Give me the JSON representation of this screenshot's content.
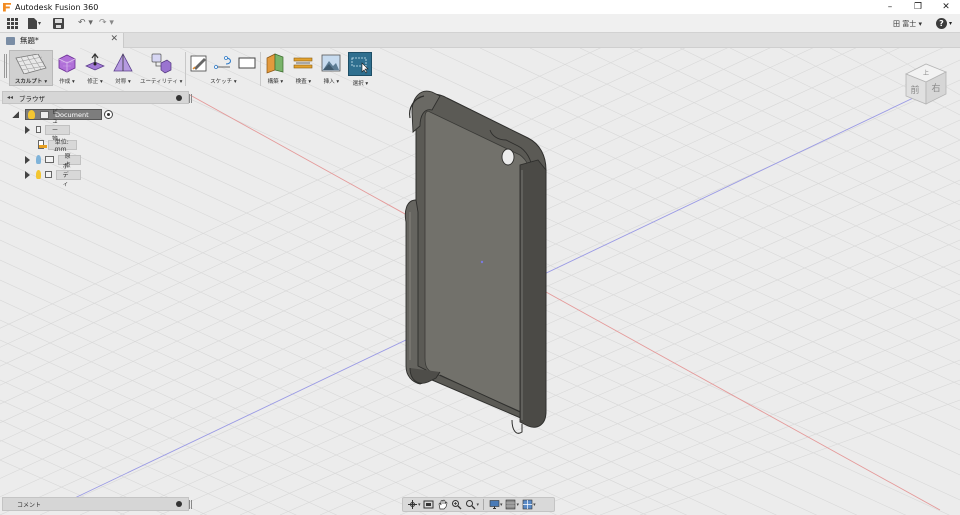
{
  "window": {
    "title": "Autodesk Fusion 360",
    "minimize": "–",
    "restore": "❐",
    "close": "✕"
  },
  "quick_access": {
    "file_icon": "▾",
    "undo": "↶ ▾",
    "redo": "↷ ▾",
    "user": "田 富士 ▾",
    "help_glyph": "?",
    "help_dd": "▾"
  },
  "document_tab": {
    "label": "無題*",
    "close": "✕"
  },
  "ribbon": {
    "workspace_label": "スカルプト ▾",
    "groups": [
      {
        "id": "create",
        "label": "作成 ▾"
      },
      {
        "id": "modify",
        "label": "修正 ▾"
      },
      {
        "id": "symmetry",
        "label": "対称 ▾"
      },
      {
        "id": "utilities",
        "label": "ユーティリティ ▾"
      },
      {
        "id": "sketch",
        "label": "スケッチ ▾"
      },
      {
        "id": "construct",
        "label": "構築 ▾"
      },
      {
        "id": "inspect",
        "label": "検査 ▾"
      },
      {
        "id": "insert",
        "label": "挿入 ▾"
      },
      {
        "id": "select",
        "label": "選択 ▾"
      }
    ]
  },
  "browser": {
    "collapse": "◂◂",
    "title": "ブラウザ",
    "items": [
      {
        "label": "Document"
      },
      {
        "label": "ビュー管理"
      },
      {
        "label": "単位: mm"
      },
      {
        "label": "原点"
      },
      {
        "label": "ボディ"
      }
    ]
  },
  "viewcube": {
    "top": "上",
    "front": "前",
    "right": "右"
  },
  "comments": {
    "title": "コメント"
  },
  "colors": {
    "accent": "#2f6f8f",
    "model": "#5b5a55",
    "axis_red": "#e08080",
    "axis_blue": "#8a8ae0"
  }
}
